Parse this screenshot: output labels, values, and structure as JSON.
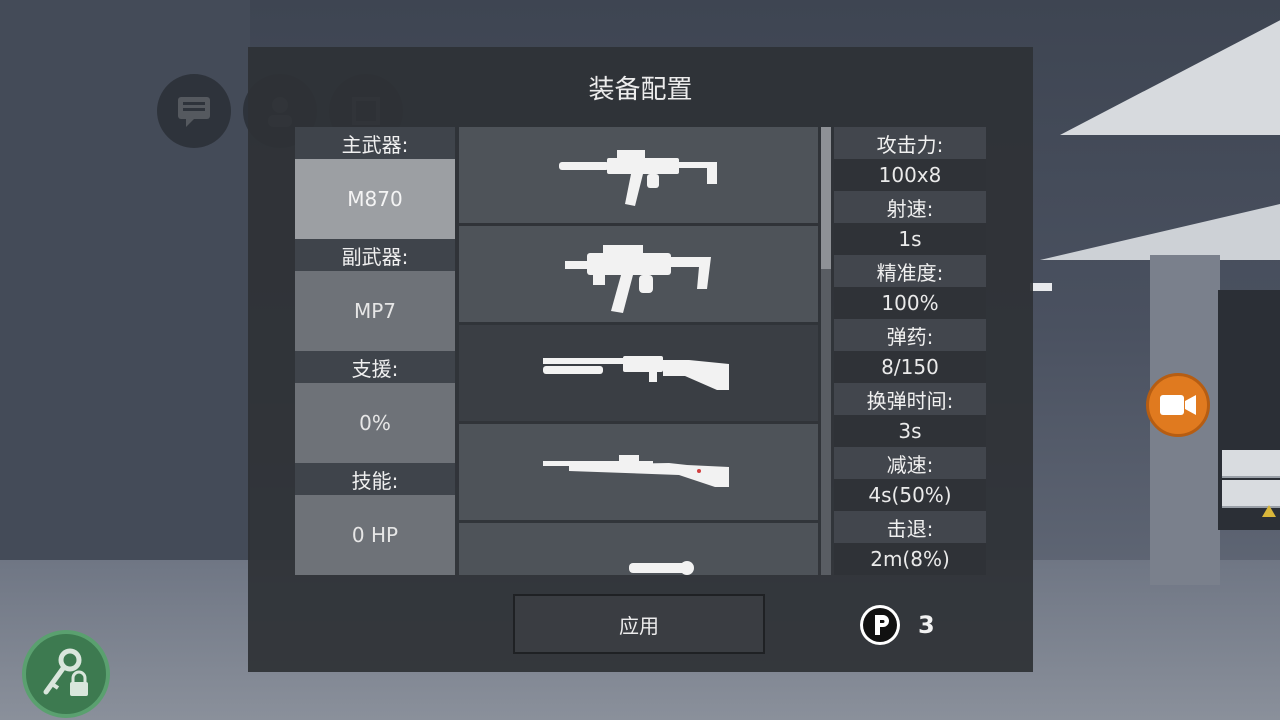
{
  "dialog": {
    "title": "装备配置",
    "categories": [
      {
        "label": "主武器:",
        "value": "M870",
        "selected": true
      },
      {
        "label": "副武器:",
        "value": "MP7",
        "selected": false
      },
      {
        "label": "支援:",
        "value": "0%",
        "selected": false
      },
      {
        "label": "技能:",
        "value": "0 HP",
        "selected": false
      }
    ],
    "weapons": [
      {
        "icon": "smg-silenced-icon"
      },
      {
        "icon": "smg-icon"
      },
      {
        "icon": "pump-shotgun-icon"
      },
      {
        "icon": "bolt-rifle-icon"
      },
      {
        "icon": "sniper-rifle-icon"
      }
    ],
    "stats": [
      {
        "label": "攻击力:",
        "value": "100x8"
      },
      {
        "label": "射速:",
        "value": "1s"
      },
      {
        "label": "精准度:",
        "value": "100%"
      },
      {
        "label": "弹药:",
        "value": "8/150"
      },
      {
        "label": "换弹时间:",
        "value": "3s"
      },
      {
        "label": "减速:",
        "value": "4s(50%)"
      },
      {
        "label": "击退:",
        "value": "2m(8%)"
      }
    ],
    "apply_label": "应用",
    "points": {
      "icon": "points-p-icon",
      "value": "3"
    }
  },
  "hud": {
    "icons": [
      "chat-icon",
      "team-icon",
      "inventory-icon",
      "camera-icon",
      "key-lock-icon"
    ],
    "colors": {
      "camera": "#e07a1f",
      "key": "#3d7a50"
    }
  }
}
